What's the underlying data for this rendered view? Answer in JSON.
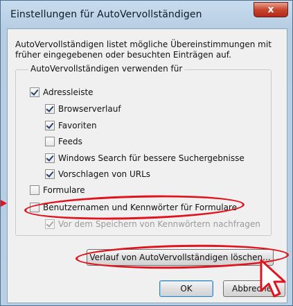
{
  "window": {
    "title": "Einstellungen für AutoVervollständigen",
    "close_label": "x"
  },
  "description": "AutoVervollständigen listet mögliche Übereinstimmungen mit früher eingegebenen oder besuchten Einträgen auf.",
  "group": {
    "label": "AutoVervollständigen verwenden für",
    "items": [
      {
        "label": "Adressleiste",
        "checked": true,
        "enabled": true
      },
      {
        "label": "Browserverlauf",
        "checked": true,
        "enabled": true
      },
      {
        "label": "Favoriten",
        "checked": true,
        "enabled": true
      },
      {
        "label": "Feeds",
        "checked": false,
        "enabled": true
      },
      {
        "label": "Windows Search für bessere Suchergebnisse",
        "checked": true,
        "enabled": true
      },
      {
        "label": "Vorschlagen von URLs",
        "checked": true,
        "enabled": true
      },
      {
        "label": "Formulare",
        "checked": false,
        "enabled": true
      },
      {
        "label": "Benutzernamen und Kennwörter für Formulare",
        "checked": false,
        "enabled": true
      },
      {
        "label": "Vor dem Speichern von Kennwörtern nachfragen",
        "checked": true,
        "enabled": false
      }
    ]
  },
  "buttons": {
    "clear_history": "Verlauf von AutoVervollständigen löschen...",
    "ok": "OK",
    "cancel": "Abbrechen"
  },
  "colors": {
    "annotation": "#e0141e",
    "close_button": "#c8452d"
  }
}
